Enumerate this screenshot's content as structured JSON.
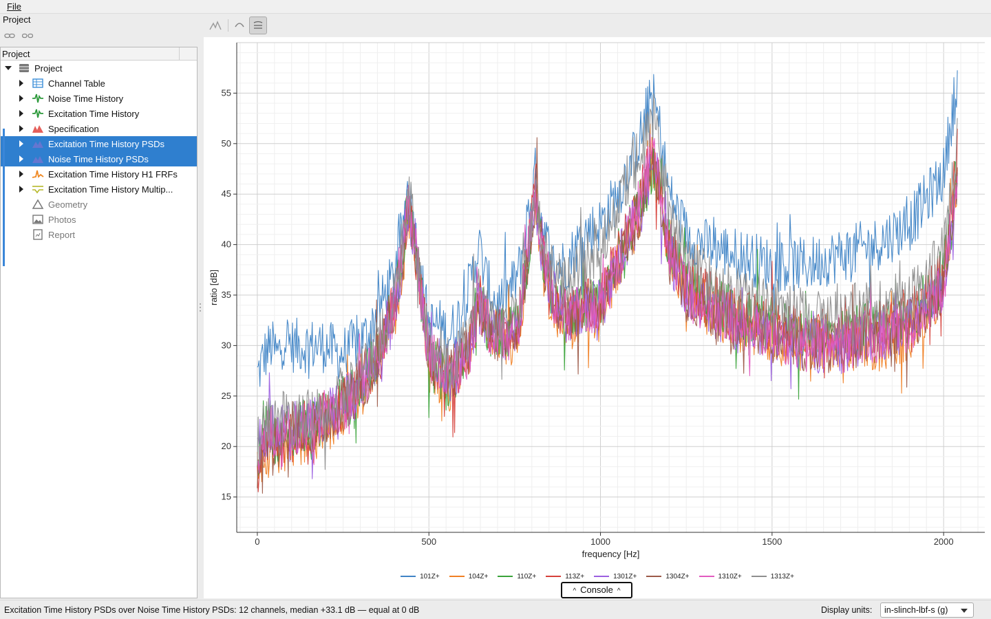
{
  "menu": {
    "file_label": "File"
  },
  "left_panel": {
    "title": "Project",
    "tree_header": "Project"
  },
  "tree": [
    {
      "label": "Project",
      "icon": "database-icon",
      "expanded": true,
      "arrow": "open",
      "selected": false,
      "dim": false,
      "indent": 1
    },
    {
      "label": "Channel Table",
      "icon": "table-icon",
      "color": "#3b8fd8",
      "arrow": "closed",
      "selected": false,
      "dim": false,
      "indent": 2
    },
    {
      "label": "Noise Time History",
      "icon": "time-history-icon",
      "color": "#2e9a3c",
      "arrow": "closed",
      "selected": false,
      "dim": false,
      "indent": 2
    },
    {
      "label": "Excitation Time History",
      "icon": "time-history-icon",
      "color": "#2e9a3c",
      "arrow": "closed",
      "selected": false,
      "dim": false,
      "indent": 2
    },
    {
      "label": "Specification",
      "icon": "specification-icon",
      "color": "#e0443e",
      "arrow": "closed",
      "selected": false,
      "dim": false,
      "indent": 2
    },
    {
      "label": "Excitation Time History PSDs",
      "icon": "psd-icon",
      "color": "#8a6fd1",
      "arrow": "closed",
      "selected": true,
      "dim": false,
      "indent": 2
    },
    {
      "label": "Noise Time History PSDs",
      "icon": "psd-icon",
      "color": "#8a6fd1",
      "arrow": "closed",
      "selected": true,
      "dim": false,
      "indent": 2
    },
    {
      "label": "Excitation Time History H1 FRFs",
      "icon": "frf-icon",
      "color": "#f08a24",
      "arrow": "closed",
      "selected": false,
      "dim": false,
      "indent": 2
    },
    {
      "label": "Excitation Time History Multip...",
      "icon": "multiple-coherence-icon",
      "color": "#b6b82a",
      "arrow": "closed",
      "selected": false,
      "dim": false,
      "indent": 2
    },
    {
      "label": "Geometry",
      "icon": "geometry-icon",
      "arrow": "none",
      "selected": false,
      "dim": true,
      "indent": 2
    },
    {
      "label": "Photos",
      "icon": "photos-icon",
      "arrow": "none",
      "selected": false,
      "dim": true,
      "indent": 2
    },
    {
      "label": "Report",
      "icon": "report-icon",
      "arrow": "none",
      "selected": false,
      "dim": true,
      "indent": 2
    }
  ],
  "plot_toolbar": [
    {
      "icon": "peak-pick-icon",
      "active": false
    },
    {
      "icon": "undo-icon",
      "active": false
    },
    {
      "icon": "stack-traces-icon",
      "active": true
    }
  ],
  "chart_data": {
    "type": "line",
    "title": "",
    "xlabel": "frequency [Hz]",
    "ylabel": "ratio [dB]",
    "xlim": [
      -60,
      2120
    ],
    "ylim": [
      11.5,
      60
    ],
    "xticks": [
      0,
      500,
      1000,
      1500,
      2000
    ],
    "yticks": [
      15,
      20,
      25,
      30,
      35,
      40,
      45,
      50,
      55
    ],
    "grid": true,
    "legend_position": "bottom",
    "x": [
      0,
      20,
      40,
      60,
      80,
      100,
      130,
      160,
      200,
      240,
      280,
      320,
      360,
      400,
      420,
      440,
      460,
      480,
      500,
      530,
      560,
      590,
      620,
      645,
      670,
      700,
      730,
      760,
      790,
      810,
      830,
      860,
      900,
      950,
      1000,
      1050,
      1100,
      1130,
      1150,
      1170,
      1200,
      1250,
      1300,
      1400,
      1500,
      1600,
      1700,
      1800,
      1900,
      1960,
      2000,
      2020,
      2040
    ],
    "series": [
      {
        "name": "101Z+",
        "color": "#3f84c6",
        "values": [
          27,
          29,
          30,
          29,
          31,
          30,
          30,
          30,
          30,
          29,
          30,
          31,
          34,
          37,
          41,
          46,
          41,
          36,
          32,
          32,
          31,
          33,
          36,
          40,
          36,
          34,
          35,
          37,
          43,
          47,
          42,
          38,
          38,
          41,
          42,
          45,
          49,
          52,
          55,
          52,
          45,
          41,
          40,
          39,
          38,
          38,
          39,
          40,
          42,
          45,
          47,
          52,
          56
        ]
      },
      {
        "name": "104Z+",
        "color": "#f08024",
        "values": [
          17,
          19,
          20,
          19,
          20,
          20,
          21,
          21,
          22,
          23,
          25,
          26,
          29,
          33,
          37,
          43,
          40,
          34,
          28,
          27,
          26,
          28,
          30,
          34,
          32,
          31,
          30,
          31,
          38,
          45,
          38,
          34,
          32,
          33,
          33,
          38,
          42,
          45,
          48,
          46,
          39,
          35,
          34,
          32,
          31,
          30,
          30,
          30,
          31,
          33,
          36,
          41,
          47
        ]
      },
      {
        "name": "110Z+",
        "color": "#3aa33a",
        "values": [
          19,
          21,
          22,
          20,
          21,
          21,
          22,
          22,
          23,
          24,
          25,
          27,
          30,
          34,
          38,
          44,
          40,
          34,
          29,
          27,
          26,
          28,
          30,
          35,
          32,
          31,
          31,
          32,
          39,
          46,
          39,
          35,
          33,
          34,
          34,
          38,
          43,
          45,
          48,
          46,
          40,
          36,
          35,
          33,
          32,
          31,
          31,
          32,
          33,
          35,
          37,
          42,
          48
        ]
      },
      {
        "name": "113Z+",
        "color": "#d6403a",
        "values": [
          18,
          20,
          21,
          20,
          21,
          21,
          22,
          22,
          23,
          24,
          25,
          27,
          30,
          34,
          38,
          44,
          40,
          34,
          29,
          28,
          27,
          28,
          30,
          35,
          32,
          31,
          31,
          32,
          40,
          48,
          39,
          35,
          33,
          34,
          34,
          39,
          43,
          46,
          49,
          46,
          40,
          36,
          35,
          33,
          32,
          31,
          31,
          32,
          33,
          35,
          37,
          43,
          49
        ]
      },
      {
        "name": "1301Z+",
        "color": "#9b5fe0",
        "values": [
          19,
          21,
          22,
          21,
          22,
          21,
          22,
          22,
          23,
          24,
          25,
          27,
          30,
          34,
          38,
          44,
          40,
          34,
          29,
          28,
          27,
          28,
          30,
          34,
          32,
          31,
          31,
          32,
          39,
          45,
          39,
          35,
          33,
          34,
          34,
          38,
          42,
          45,
          48,
          46,
          39,
          35,
          34,
          32,
          31,
          30,
          30,
          31,
          32,
          34,
          36,
          41,
          47
        ]
      },
      {
        "name": "1304Z+",
        "color": "#9c5a48",
        "values": [
          18,
          20,
          21,
          20,
          21,
          21,
          22,
          22,
          23,
          24,
          25,
          27,
          30,
          34,
          38,
          43,
          40,
          34,
          29,
          28,
          27,
          28,
          30,
          34,
          32,
          31,
          31,
          32,
          39,
          45,
          39,
          35,
          33,
          34,
          34,
          38,
          42,
          45,
          48,
          46,
          39,
          35,
          34,
          32,
          31,
          30,
          30,
          31,
          32,
          34,
          36,
          41,
          47
        ]
      },
      {
        "name": "1310Z+",
        "color": "#e25bc0",
        "values": [
          19,
          21,
          22,
          20,
          21,
          21,
          22,
          22,
          23,
          24,
          25,
          27,
          30,
          34,
          39,
          45,
          40,
          34,
          29,
          28,
          27,
          28,
          30,
          34,
          32,
          31,
          31,
          32,
          40,
          46,
          39,
          35,
          33,
          34,
          34,
          38,
          43,
          46,
          49,
          46,
          40,
          35,
          34,
          32,
          31,
          30,
          30,
          31,
          32,
          34,
          36,
          42,
          48
        ]
      },
      {
        "name": "1313Z+",
        "color": "#8e8e8e",
        "values": [
          20,
          22,
          23,
          22,
          23,
          22,
          23,
          23,
          24,
          25,
          26,
          28,
          31,
          35,
          39,
          45,
          41,
          35,
          30,
          29,
          28,
          29,
          31,
          35,
          33,
          32,
          32,
          33,
          40,
          46,
          40,
          37,
          36,
          38,
          40,
          44,
          48,
          50,
          53,
          50,
          43,
          38,
          37,
          35,
          34,
          33,
          33,
          34,
          35,
          37,
          40,
          44,
          50
        ]
      }
    ]
  },
  "console": {
    "label": "Console"
  },
  "status": {
    "text": "Excitation Time History PSDs over Noise Time History PSDs: 12 channels, median +33.1 dB — equal at 0 dB",
    "units_label": "Display units:",
    "units_value": "in-slinch-lbf-s (g)"
  }
}
